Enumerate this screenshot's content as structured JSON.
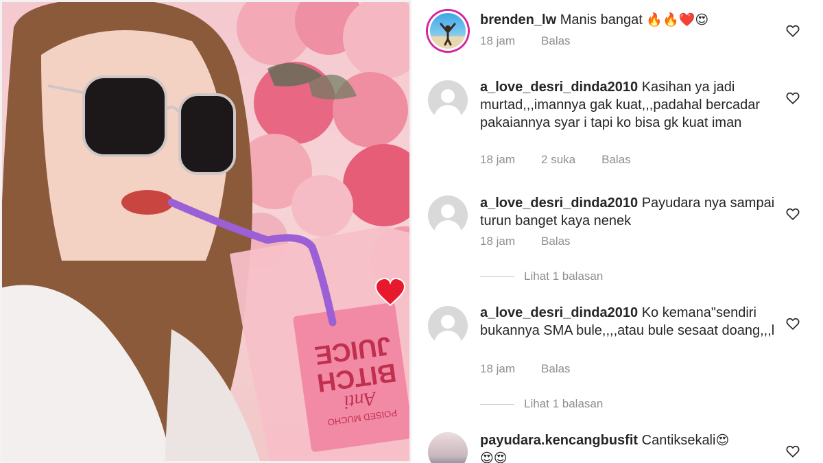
{
  "photo": {
    "product_text": [
      "Anti",
      "BITCH",
      "JUICE"
    ],
    "brand_text": "POISED MUCHO",
    "overlay_icon": "heart-icon",
    "colors": {
      "roses": "#f08aa0",
      "pouch": "#f7a9b8",
      "straw": "#9b5fd6",
      "coat": "#f3efee",
      "hair": "#8a5a3a"
    }
  },
  "comments": [
    {
      "username": "brenden_lw",
      "text": "Manis bangat",
      "emojis": "🔥🔥❤️😍",
      "time": "18 jam",
      "likes": "",
      "reply": "Balas",
      "avatar": "story-avatar"
    },
    {
      "username": "a_love_desri_dinda2010",
      "text": "Kasihan ya jadi murtad,,,imannya gak kuat,,,padahal bercadar pakaiannya syar i tapi ko bisa gk kuat iman",
      "time": "18 jam",
      "likes": "2 suka",
      "reply": "Balas",
      "avatar": "default-avatar"
    },
    {
      "username": "a_love_desri_dinda2010",
      "text": "Payudara nya sampai turun banget kaya nenek",
      "time": "18 jam",
      "likes": "",
      "reply": "Balas",
      "avatar": "default-avatar",
      "view_replies": "Lihat 1 balasan"
    },
    {
      "username": "a_love_desri_dinda2010",
      "text": "Ko kemana\"sendiri bukannya SMA bule,,,,atau bule sesaat doang,,,l",
      "time": "18 jam",
      "likes": "",
      "reply": "Balas",
      "avatar": "default-avatar",
      "view_replies": "Lihat 1 balasan"
    },
    {
      "username": "payudara.kencangbusfit",
      "text": "Cantiksekali",
      "emojis": "😍",
      "emojis_line2": "😍😍",
      "avatar": "photo-avatar"
    }
  ],
  "icons": {
    "like": "heart-outline-icon"
  },
  "colors": {
    "meta_text": "#8e8e8e",
    "body_text": "#262626",
    "story_ring": "#d6249f"
  }
}
